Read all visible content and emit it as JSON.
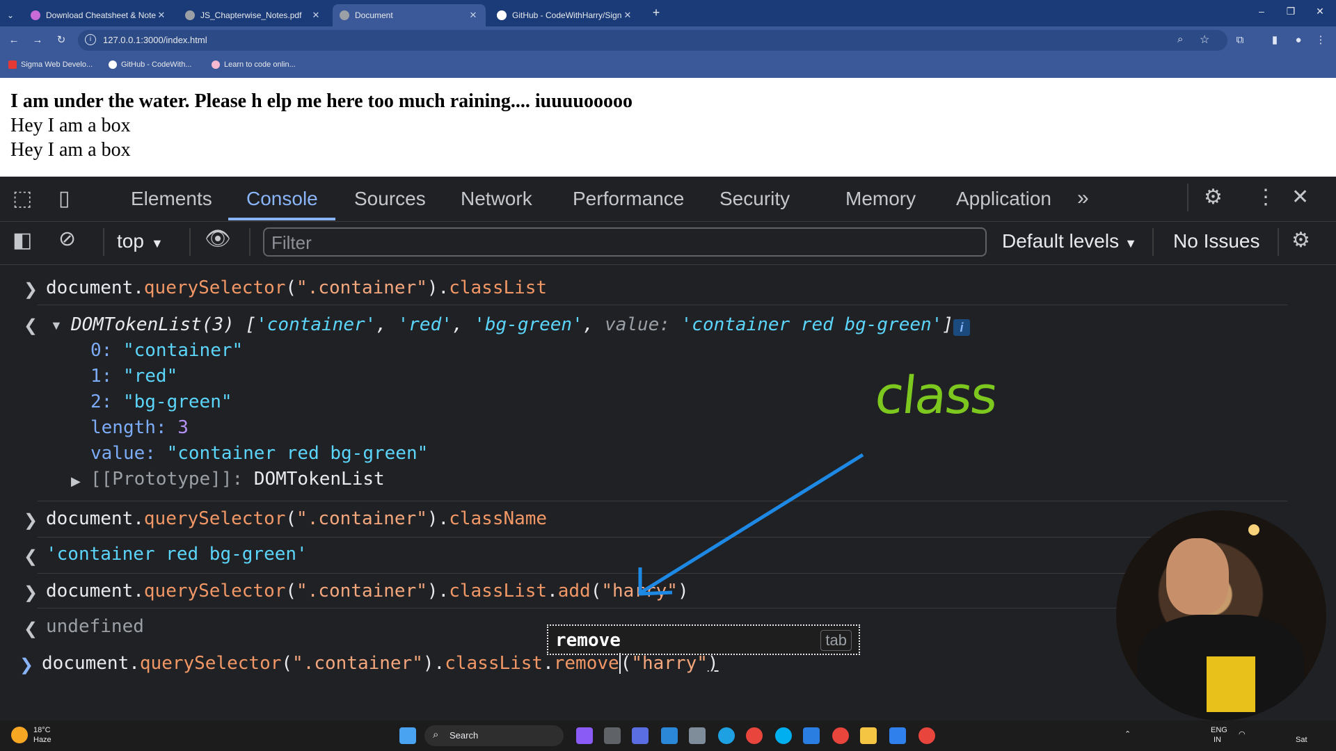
{
  "tabs": [
    {
      "title": "Download Cheatsheet & Note",
      "active": false
    },
    {
      "title": "JS_Chapterwise_Notes.pdf",
      "active": false
    },
    {
      "title": "Document",
      "active": true
    },
    {
      "title": "GitHub - CodeWithHarry/Sign",
      "active": false
    }
  ],
  "address_bar": {
    "url": "127.0.0.1:3000/index.html"
  },
  "bookmarks": [
    "Sigma Web Develo...",
    "GitHub - CodeWith...",
    "Learn to code onlin..."
  ],
  "page": {
    "heading": "I am under the water. Please h elp me here too much raining.... iuuuuooooo",
    "lines": [
      "Hey I am a box",
      "Hey I am a box"
    ]
  },
  "devtools": {
    "tabs": [
      "Elements",
      "Console",
      "Sources",
      "Network",
      "Performance",
      "Security",
      "Memory",
      "Application"
    ],
    "active_tab": "Console",
    "context": "top",
    "filter_placeholder": "Filter",
    "levels": "Default levels",
    "issues": "No Issues"
  },
  "console": {
    "c1": {
      "prefix": "document.",
      "method": "querySelector",
      "open": "(",
      "arg": "\".container\"",
      "close": ").",
      "prop": "classList"
    },
    "dom_token": {
      "head": "DOMTokenList(3) [",
      "v1": "'container'",
      "v2": "'red'",
      "v3": "'bg-green'",
      "vkey": "value:",
      "vval": "'container red bg-green'",
      "tail": "]",
      "i0k": "0:",
      "i0v": "\"container\"",
      "i1k": "1:",
      "i1v": "\"red\"",
      "i2k": "2:",
      "i2v": "\"bg-green\"",
      "lenk": "length:",
      "lenv": "3",
      "valk": "value:",
      "valv": "\"container red bg-green\"",
      "protok": "[[Prototype]]:",
      "protov": "DOMTokenList"
    },
    "c2": {
      "prefix": "document.",
      "method": "querySelector",
      "open": "(",
      "arg": "\".container\"",
      "close": ").",
      "prop": "className"
    },
    "r2": "'container red bg-green'",
    "c3": {
      "prefix": "document.",
      "method": "querySelector",
      "open": "(",
      "arg": "\".container\"",
      "close": ").",
      "prop": "classList",
      "dot": ".",
      "fn": "add",
      "open2": "(",
      "arg2": "\"harry\"",
      "close2": ")"
    },
    "r3": "undefined",
    "c4": {
      "prefix": "document.",
      "method": "querySelector",
      "open": "(",
      "arg": "\".container\"",
      "close": ").",
      "prop": "classList",
      "dot": ".",
      "fn": "remove",
      "open2": "(",
      "arg2": "\"harry\"",
      "close2": ")"
    },
    "autocomplete": {
      "label": "remove",
      "hint": "tab"
    }
  },
  "annotation": {
    "text": "class"
  },
  "taskbar": {
    "weather_temp": "18°C",
    "weather_cond": "Haze",
    "search": "Search",
    "lang1": "ENG",
    "lang2": "IN",
    "day": "Sat"
  },
  "colors": {
    "tab_bar": "#1b3b78",
    "toolbar": "#3b5998",
    "console_bg": "#202124",
    "accent": "#8ab4f8",
    "annotation_green": "#7dc81e",
    "arrow_blue": "#1e88e5"
  }
}
